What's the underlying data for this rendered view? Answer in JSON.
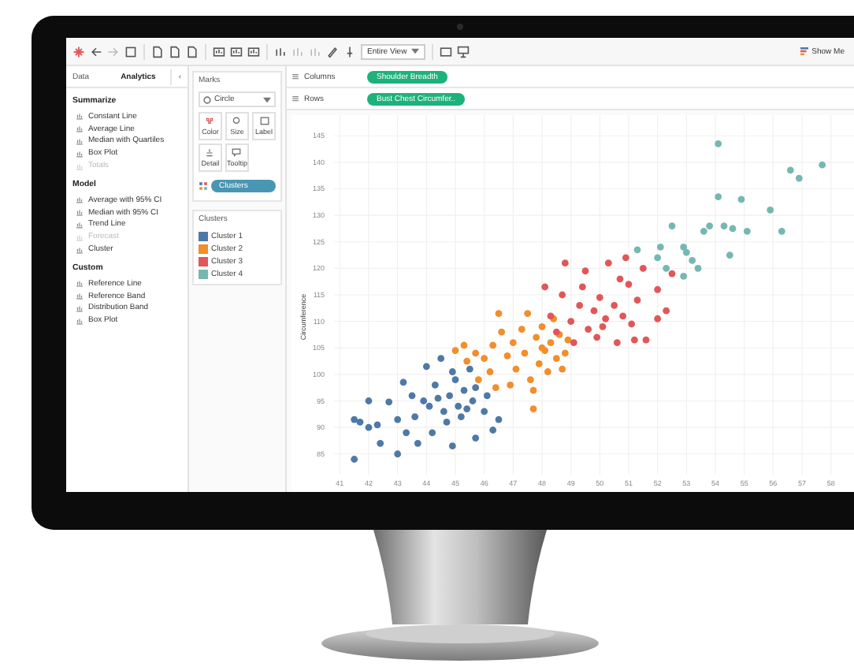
{
  "toolbar": {
    "fit_dropdown": "Entire View",
    "show_me": "Show Me"
  },
  "side_tabs": [
    {
      "label": "Data",
      "selected": false
    },
    {
      "label": "Analytics",
      "selected": true
    }
  ],
  "side_collapse": "‹",
  "analytics": [
    {
      "heading": "Summarize",
      "items": [
        {
          "label": "Constant Line",
          "disabled": false
        },
        {
          "label": "Average Line",
          "disabled": false
        },
        {
          "label": "Median with Quartiles",
          "disabled": false
        },
        {
          "label": "Box Plot",
          "disabled": false
        },
        {
          "label": "Totals",
          "disabled": true
        }
      ]
    },
    {
      "heading": "Model",
      "items": [
        {
          "label": "Average with 95% CI",
          "disabled": false
        },
        {
          "label": "Median with 95% CI",
          "disabled": false
        },
        {
          "label": "Trend Line",
          "disabled": false
        },
        {
          "label": "Forecast",
          "disabled": true
        },
        {
          "label": "Cluster",
          "disabled": false
        }
      ]
    },
    {
      "heading": "Custom",
      "items": [
        {
          "label": "Reference Line",
          "disabled": false
        },
        {
          "label": "Reference Band",
          "disabled": false
        },
        {
          "label": "Distribution Band",
          "disabled": false
        },
        {
          "label": "Box Plot",
          "disabled": false
        }
      ]
    }
  ],
  "marks": {
    "title": "Marks",
    "mark_type": "Circle",
    "buttons": [
      {
        "label": "Color",
        "kind": "color"
      },
      {
        "label": "Size",
        "kind": "size"
      },
      {
        "label": "Label",
        "kind": "label"
      },
      {
        "label": "Detail",
        "kind": "detail"
      },
      {
        "label": "Tooltip",
        "kind": "tooltip"
      }
    ],
    "pill": "Clusters"
  },
  "legend": {
    "title": "Clusters"
  },
  "shelves": [
    {
      "label": "Columns",
      "pill": "Shoulder Breadth"
    },
    {
      "label": "Rows",
      "pill": "Bust Chest Circumfer.."
    }
  ],
  "chart_data": {
    "type": "scatter",
    "ylabel": "Circumference",
    "xlim": [
      40.8,
      58.8
    ],
    "ylim": [
      81.1,
      148.9
    ],
    "grid": true,
    "xticks": [
      41,
      42,
      43,
      44,
      45,
      46,
      47,
      48,
      49,
      50,
      51,
      52,
      53,
      54,
      55,
      56,
      57,
      58
    ],
    "yticks": [
      85,
      90,
      95,
      100,
      105,
      110,
      115,
      120,
      125,
      130,
      135,
      140,
      145
    ],
    "series": [
      {
        "name": "Cluster 1",
        "color": "#4e79a7",
        "x": [
          41.5,
          41.5,
          41.7,
          42,
          42,
          42.3,
          42.4,
          42.7,
          43,
          43,
          43.2,
          43.3,
          43.5,
          43.6,
          43.7,
          43.9,
          44,
          44.1,
          44.2,
          44.3,
          44.5,
          44.6,
          44.7,
          44.8,
          44.9,
          45,
          45.1,
          45.2,
          45.3,
          45.5,
          45.6,
          45.7,
          45.7,
          46,
          46.1,
          46.3,
          46.5,
          44.9,
          45.4,
          44.4
        ],
        "values": [
          84,
          91.5,
          91,
          90,
          95,
          90.5,
          87,
          94.8,
          85,
          91.5,
          98.5,
          89,
          96,
          92,
          87,
          95,
          101.5,
          94,
          89,
          98,
          103,
          93,
          91,
          96,
          86.5,
          99,
          94,
          92,
          97,
          101,
          95,
          88,
          97.5,
          93,
          96,
          89.5,
          91.5,
          100.5,
          93.5,
          95.5
        ]
      },
      {
        "name": "Cluster 2",
        "color": "#f28e2b",
        "x": [
          45,
          45.3,
          45.4,
          45.7,
          45.8,
          46,
          46.2,
          46.3,
          46.5,
          46.6,
          46.8,
          46.9,
          47,
          47.1,
          47.3,
          47.4,
          47.5,
          47.6,
          47.7,
          47.8,
          47.9,
          48,
          48.1,
          48.2,
          48.3,
          48.4,
          48.5,
          48.6,
          48.7,
          48.8,
          47.7,
          46.4,
          48.9,
          48
        ],
        "values": [
          104.5,
          105.5,
          102.5,
          104,
          99,
          103,
          100.5,
          105.5,
          111.5,
          108,
          103.5,
          98,
          106,
          101,
          108.5,
          104,
          111.5,
          99,
          97,
          107,
          102,
          109,
          104.5,
          100.5,
          106,
          110.5,
          103,
          107.5,
          101,
          104,
          93.5,
          97.5,
          106.5,
          105
        ]
      },
      {
        "name": "Cluster 3",
        "color": "#e15759",
        "x": [
          48.1,
          48.3,
          48.5,
          48.7,
          48.8,
          49,
          49.1,
          49.3,
          49.4,
          49.5,
          49.6,
          49.8,
          49.9,
          50,
          50.1,
          50.2,
          50.3,
          50.5,
          50.6,
          50.7,
          50.8,
          50.9,
          51,
          51.1,
          51.2,
          51.3,
          51.5,
          51.6,
          52,
          52,
          52.3,
          52.5
        ],
        "values": [
          116.5,
          111,
          108,
          115,
          121,
          110,
          106,
          113,
          116.5,
          119.5,
          108.5,
          112,
          107,
          114.5,
          109,
          110.5,
          121,
          113,
          106,
          118,
          111,
          122,
          117,
          109.5,
          106.5,
          114,
          120,
          106.5,
          116,
          110.5,
          112,
          119
        ]
      },
      {
        "name": "Cluster 4",
        "color": "#76b7b2",
        "x": [
          51.3,
          52,
          52.1,
          52.3,
          52.5,
          52.9,
          52.9,
          53,
          53.2,
          53.4,
          53.6,
          53.8,
          54.1,
          54.1,
          54.3,
          54.5,
          54.6,
          54.9,
          55.1,
          55.9,
          56.3,
          56.6,
          56.9,
          57.7
        ],
        "values": [
          123.5,
          122,
          124,
          120,
          128,
          124,
          118.5,
          123,
          121.5,
          120,
          127,
          128,
          133.5,
          143.5,
          128,
          122.5,
          127.5,
          133,
          127,
          131,
          127,
          138.5,
          137,
          139.5
        ]
      }
    ]
  }
}
